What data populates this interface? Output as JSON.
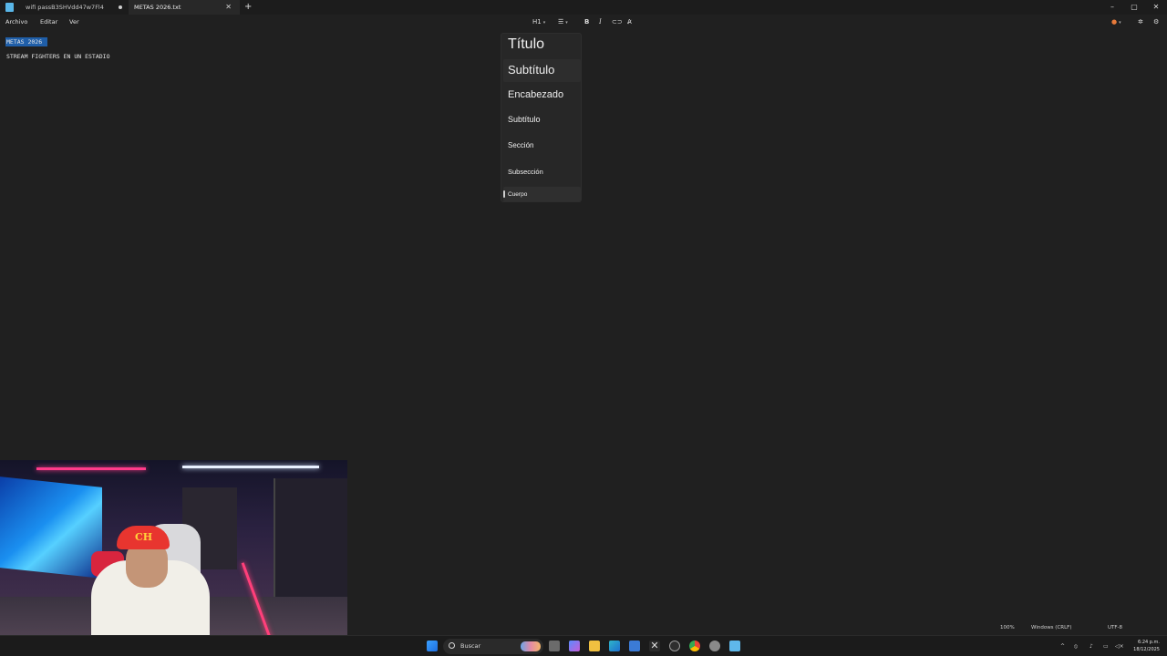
{
  "tabs": [
    {
      "label": "wifi passB3SHVdd47w7Fl4",
      "active": false,
      "modified": true
    },
    {
      "label": "METAS 2026.txt",
      "active": true,
      "modified": false
    }
  ],
  "menu": {
    "file": "Archivo",
    "edit": "Editar",
    "view": "Ver"
  },
  "toolbar": {
    "heading": "H1",
    "bold": "B",
    "italic": "I"
  },
  "editor": {
    "lines": [
      "METAS 2026",
      "STREAM FIGHTERS EN UN ESTADIO"
    ],
    "selected_line": 0
  },
  "heading_menu": {
    "items": [
      "Título",
      "Subtítulo",
      "Encabezado",
      "Subtítulo",
      "Sección",
      "Subsección",
      "Cuerpo"
    ],
    "hovered": 1,
    "current": 6
  },
  "status": {
    "zoom": "100%",
    "line_ending": "Windows (CRLF)",
    "encoding": "UTF-8"
  },
  "taskbar": {
    "search_label": "Buscar",
    "time": "6:24 p.m.",
    "date": "18/12/2025"
  },
  "colors": {
    "background": "#202020",
    "selection": "#1f5ea8",
    "accent": "#59b6e8"
  }
}
